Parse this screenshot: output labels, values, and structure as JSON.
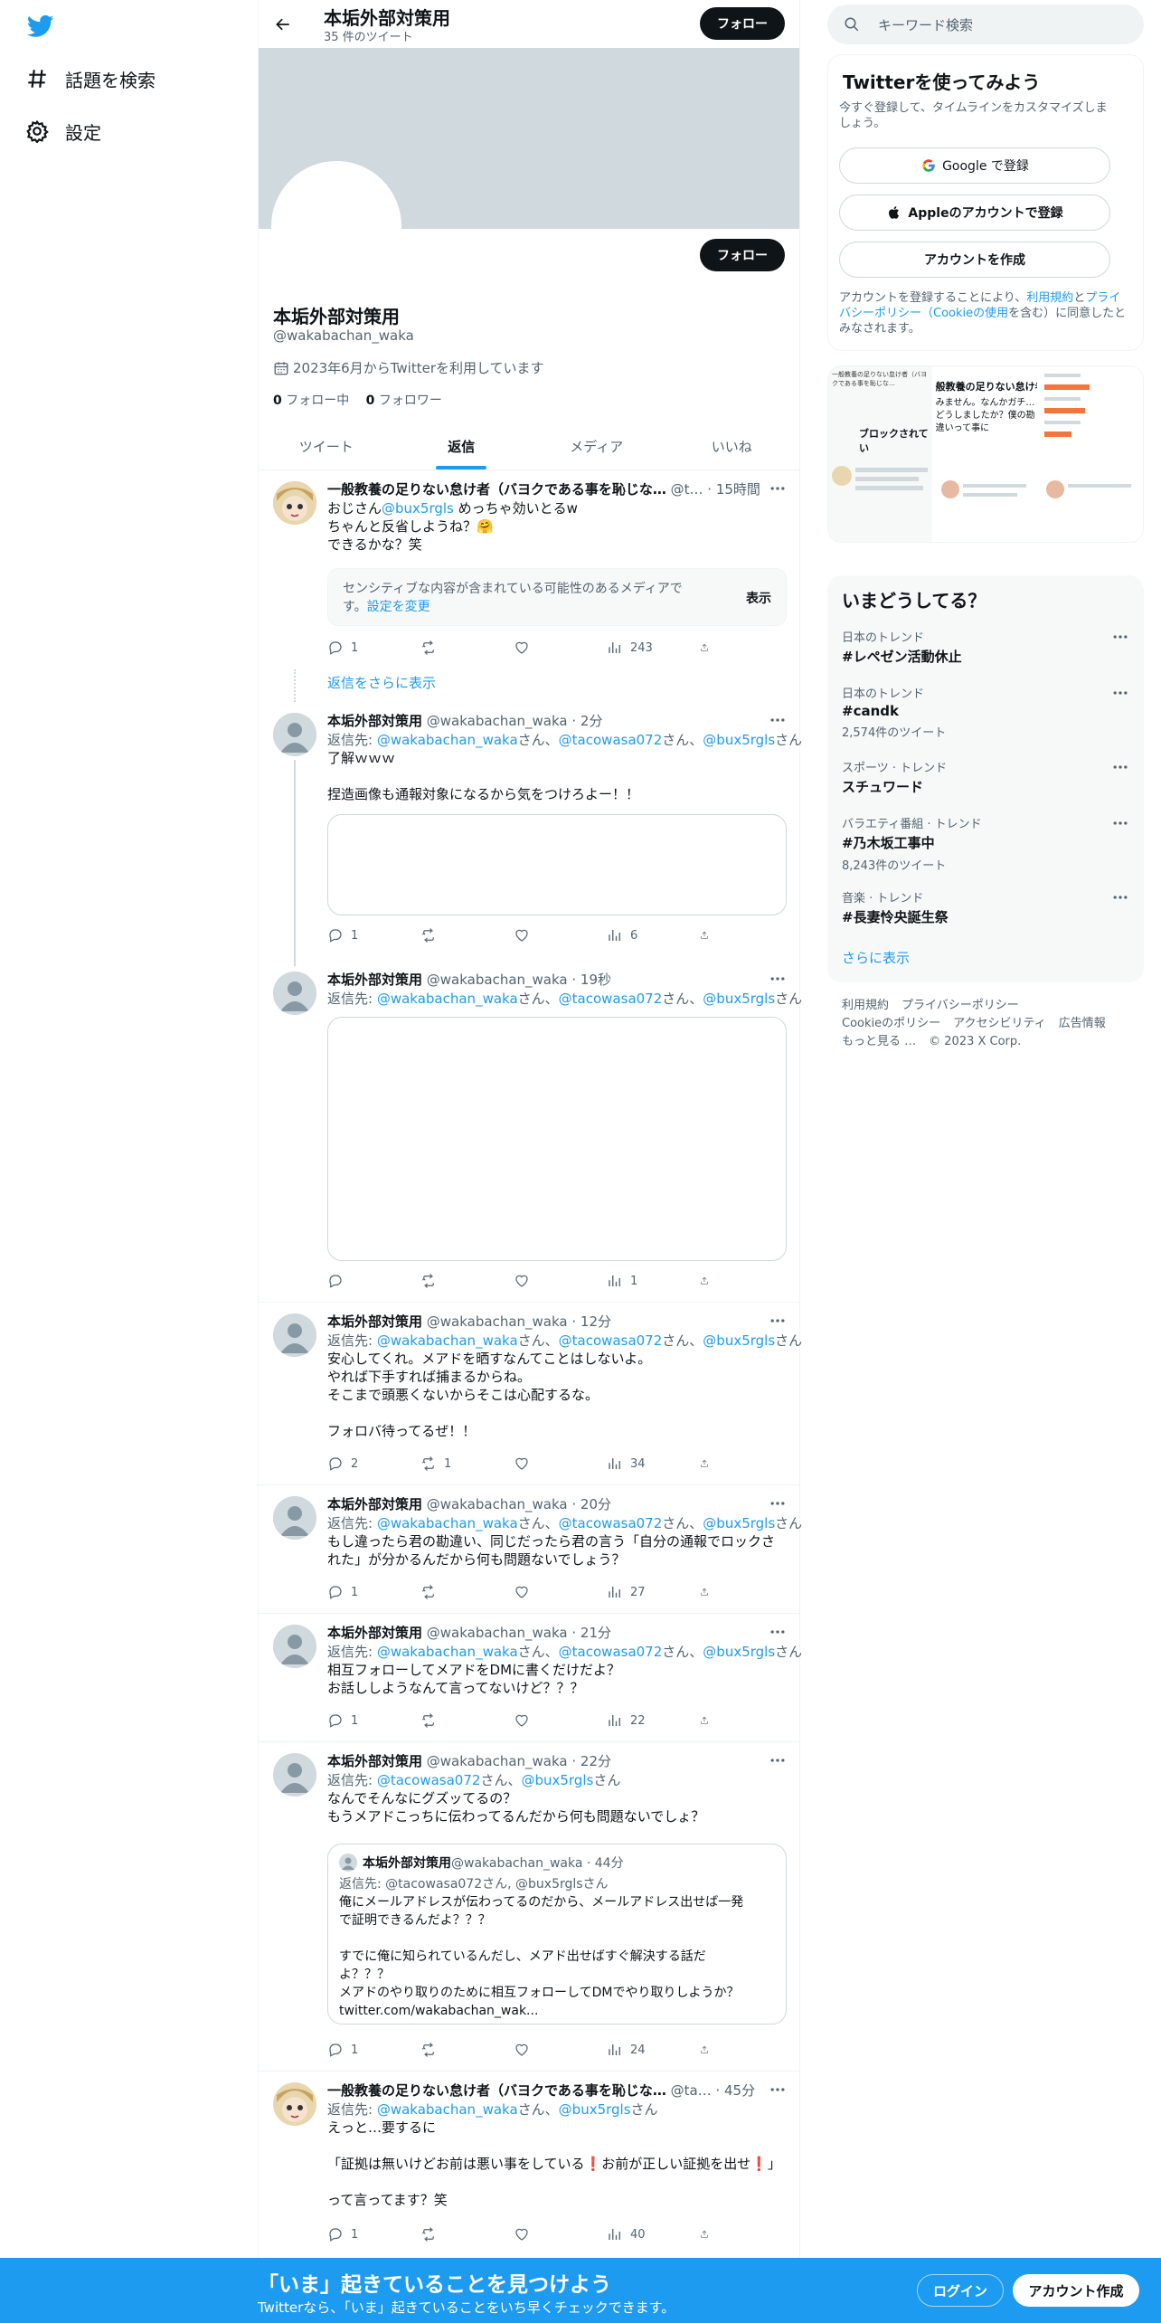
{
  "nav": {
    "explore": "話題を検索",
    "settings": "設定"
  },
  "header": {
    "title": "本垢外部対策用",
    "tweet_count": "35 件のツイート",
    "follow": "フォロー"
  },
  "profile": {
    "name": "本垢外部対策用",
    "handle": "@wakabachan_waka",
    "joined": "2023年6月からTwitterを利用しています",
    "following_count": "0",
    "following_label": " フォロー中",
    "followers_count": "0",
    "followers_label": " フォロワー",
    "follow": "フォロー"
  },
  "tabs": [
    "ツイート",
    "返信",
    "メディア",
    "いいね"
  ],
  "tweets": [
    {
      "name": "一般教養の足りない怠け者（バヨクである事を恥じな…",
      "meta": " @t… · 15時間",
      "lines": [
        "おじさん",
        "@bux5rgls",
        " めっちゃ効いとるw",
        "ちゃんと反省しようね？🤗",
        "できるかな？笑"
      ],
      "sensitive": "センシティブな内容が含まれている可能性のあるメディアです。",
      "settings_link": "設定を変更",
      "show": "表示",
      "counts": {
        "reply": "1",
        "retweet": "",
        "like": "",
        "views": "243"
      }
    },
    {
      "more_replies": "返信をさらに表示"
    },
    {
      "name": "本垢外部対策用",
      "meta": " @wakabachan_waka · 2分",
      "reply_to_label": "返信先: ",
      "reply_to": [
        "@wakabachan_waka",
        "さん、",
        "@tacowasa072",
        "さん、",
        "@bux5rgls",
        "さん"
      ],
      "lines": [
        "了解ｗｗｗ",
        "",
        "捏造画像も通報対象になるから気をつけろよー！！"
      ],
      "counts": {
        "reply": "1",
        "retweet": "",
        "like": "",
        "views": "6"
      }
    },
    {
      "name": "本垢外部対策用",
      "meta": " @wakabachan_waka · 19秒",
      "counts": {
        "reply": "",
        "retweet": "",
        "like": "",
        "views": "1"
      }
    },
    {
      "name": "本垢外部対策用",
      "meta": " @wakabachan_waka · 12分",
      "lines": [
        "安心してくれ。メアドを晒すなんてことはしないよ。",
        "やれば下手すれば捕まるからね。",
        "そこまで頭悪くないからそこは心配するな。",
        "",
        "フォロバ待ってるぜ！！"
      ],
      "counts": {
        "reply": "2",
        "retweet": "1",
        "like": "",
        "views": "34"
      }
    },
    {
      "name": "本垢外部対策用",
      "meta": " @wakabachan_waka · 20分",
      "lines": [
        "もし違ったら君の勘違い、同じだったら君の言う「自分の通報でロックさ",
        "れた」が分かるんだから何も問題ないでしょう？"
      ],
      "counts": {
        "reply": "1",
        "retweet": "",
        "like": "",
        "views": "27"
      }
    },
    {
      "name": "本垢外部対策用",
      "meta": " @wakabachan_waka · 21分",
      "lines": [
        "相互フォローしてメアドをDMに書くだけだよ？",
        "お話ししようなんて言ってないけど？？？"
      ],
      "counts": {
        "reply": "1",
        "retweet": "",
        "like": "",
        "views": "22"
      }
    },
    {
      "name": "本垢外部対策用",
      "meta": " @wakabachan_waka · 22分",
      "reply_to": [
        "@tacowasa072",
        "さん、",
        "@bux5rgls",
        "さん"
      ],
      "lines": [
        "なんでそんなにグズッてるの？",
        "もうメアドこっちに伝わってるんだから何も問題ないでしょ？"
      ],
      "quote": {
        "name": "本垢外部対策用",
        "meta": " @wakabachan_waka · 44分",
        "reply_to": "返信先: @tacowasa072さん, @bux5rglsさん",
        "lines": [
          "俺にメールアドレスが伝わってるのだから、メールアドレス出せば一発",
          "で証明できるんだよ？？？",
          "",
          "すでに俺に知られているんだし、メアド出せばすぐ解決する話だ",
          "よ？？？",
          "メアドのやり取りのために相互フォローしてDMでやり取りしようか？",
          "twitter.com/wakabachan_wak..."
        ]
      },
      "counts": {
        "reply": "1",
        "retweet": "",
        "like": "",
        "views": "24"
      }
    },
    {
      "name": "一般教養の足りない怠け者（バヨクである事を恥じな…",
      "meta": " @ta… · 45分",
      "reply_to": [
        "@wakabachan_waka",
        "さん、",
        "@bux5rgls",
        "さん"
      ],
      "lines": [
        "えっと…要するに",
        "",
        "「証拠は無いけどお前は悪い事をしている❗お前が正しい証拠を出せ❗」",
        "",
        "って言ってます？笑"
      ],
      "counts": {
        "reply": "1",
        "retweet": "",
        "like": "",
        "views": "40"
      }
    }
  ],
  "right": {
    "search_placeholder": "キーワード検索",
    "signup": {
      "title": "Twitterを使ってみよう",
      "desc1": "今すぐ登録して、タイムラインをカスタマイズしま",
      "desc2": "しょう。",
      "google": "Google で登録",
      "apple": "Appleのアカウントで登録",
      "create": "アカウントを作成",
      "terms": [
        "アカウントを登録することにより、",
        "利用規約",
        "と",
        "プライ",
        "バシーポリシー（Cookieの使用",
        "を含む）に同意したと",
        "みなされます。"
      ]
    },
    "thumbs": [
      {
        "title": "一般教養の足りない怠け者（バヨクである事を恥じな…",
        "text": "ブロックされてい"
      },
      {
        "title": "般教養の足りない怠け者",
        "text": "みません。なんかガチ…どうしましたか？僕の勘違いって事に"
      },
      {
        "title": "",
        "text": ""
      }
    ],
    "trends_title": "いまどうしてる？",
    "trends": [
      {
        "cat": "日本のトレンド",
        "title": "#レペゼン活動休止",
        "count": ""
      },
      {
        "cat": "日本のトレンド",
        "title": "#candk",
        "count": "2,574件のツイート"
      },
      {
        "cat": "スポーツ · トレンド",
        "title": "スチュワード",
        "count": ""
      },
      {
        "cat": "バラエティ番組 · トレンド",
        "title": "#乃木坂工事中",
        "count": "8,243件のツイート"
      },
      {
        "cat": "音楽 · トレンド",
        "title": "#長妻怜央誕生祭",
        "count": ""
      }
    ],
    "show_more": "さらに表示",
    "footer": [
      "利用規約",
      "プライバシーポリシー",
      "Cookieのポリシー",
      "アクセシビリティ",
      "広告情報",
      "もっと見る …",
      "© 2023 X Corp."
    ]
  },
  "bottom": {
    "title": "「いま」起きていることを見つけよう",
    "sub": "Twitterなら、「いま」起きていることをいち早くチェックできます。",
    "login": "ログイン",
    "signup": "アカウント作成"
  },
  "colors": {
    "accent": "#1d9bf0",
    "text": "#0f1419",
    "muted": "#536471",
    "banner": "#cfd9de"
  }
}
